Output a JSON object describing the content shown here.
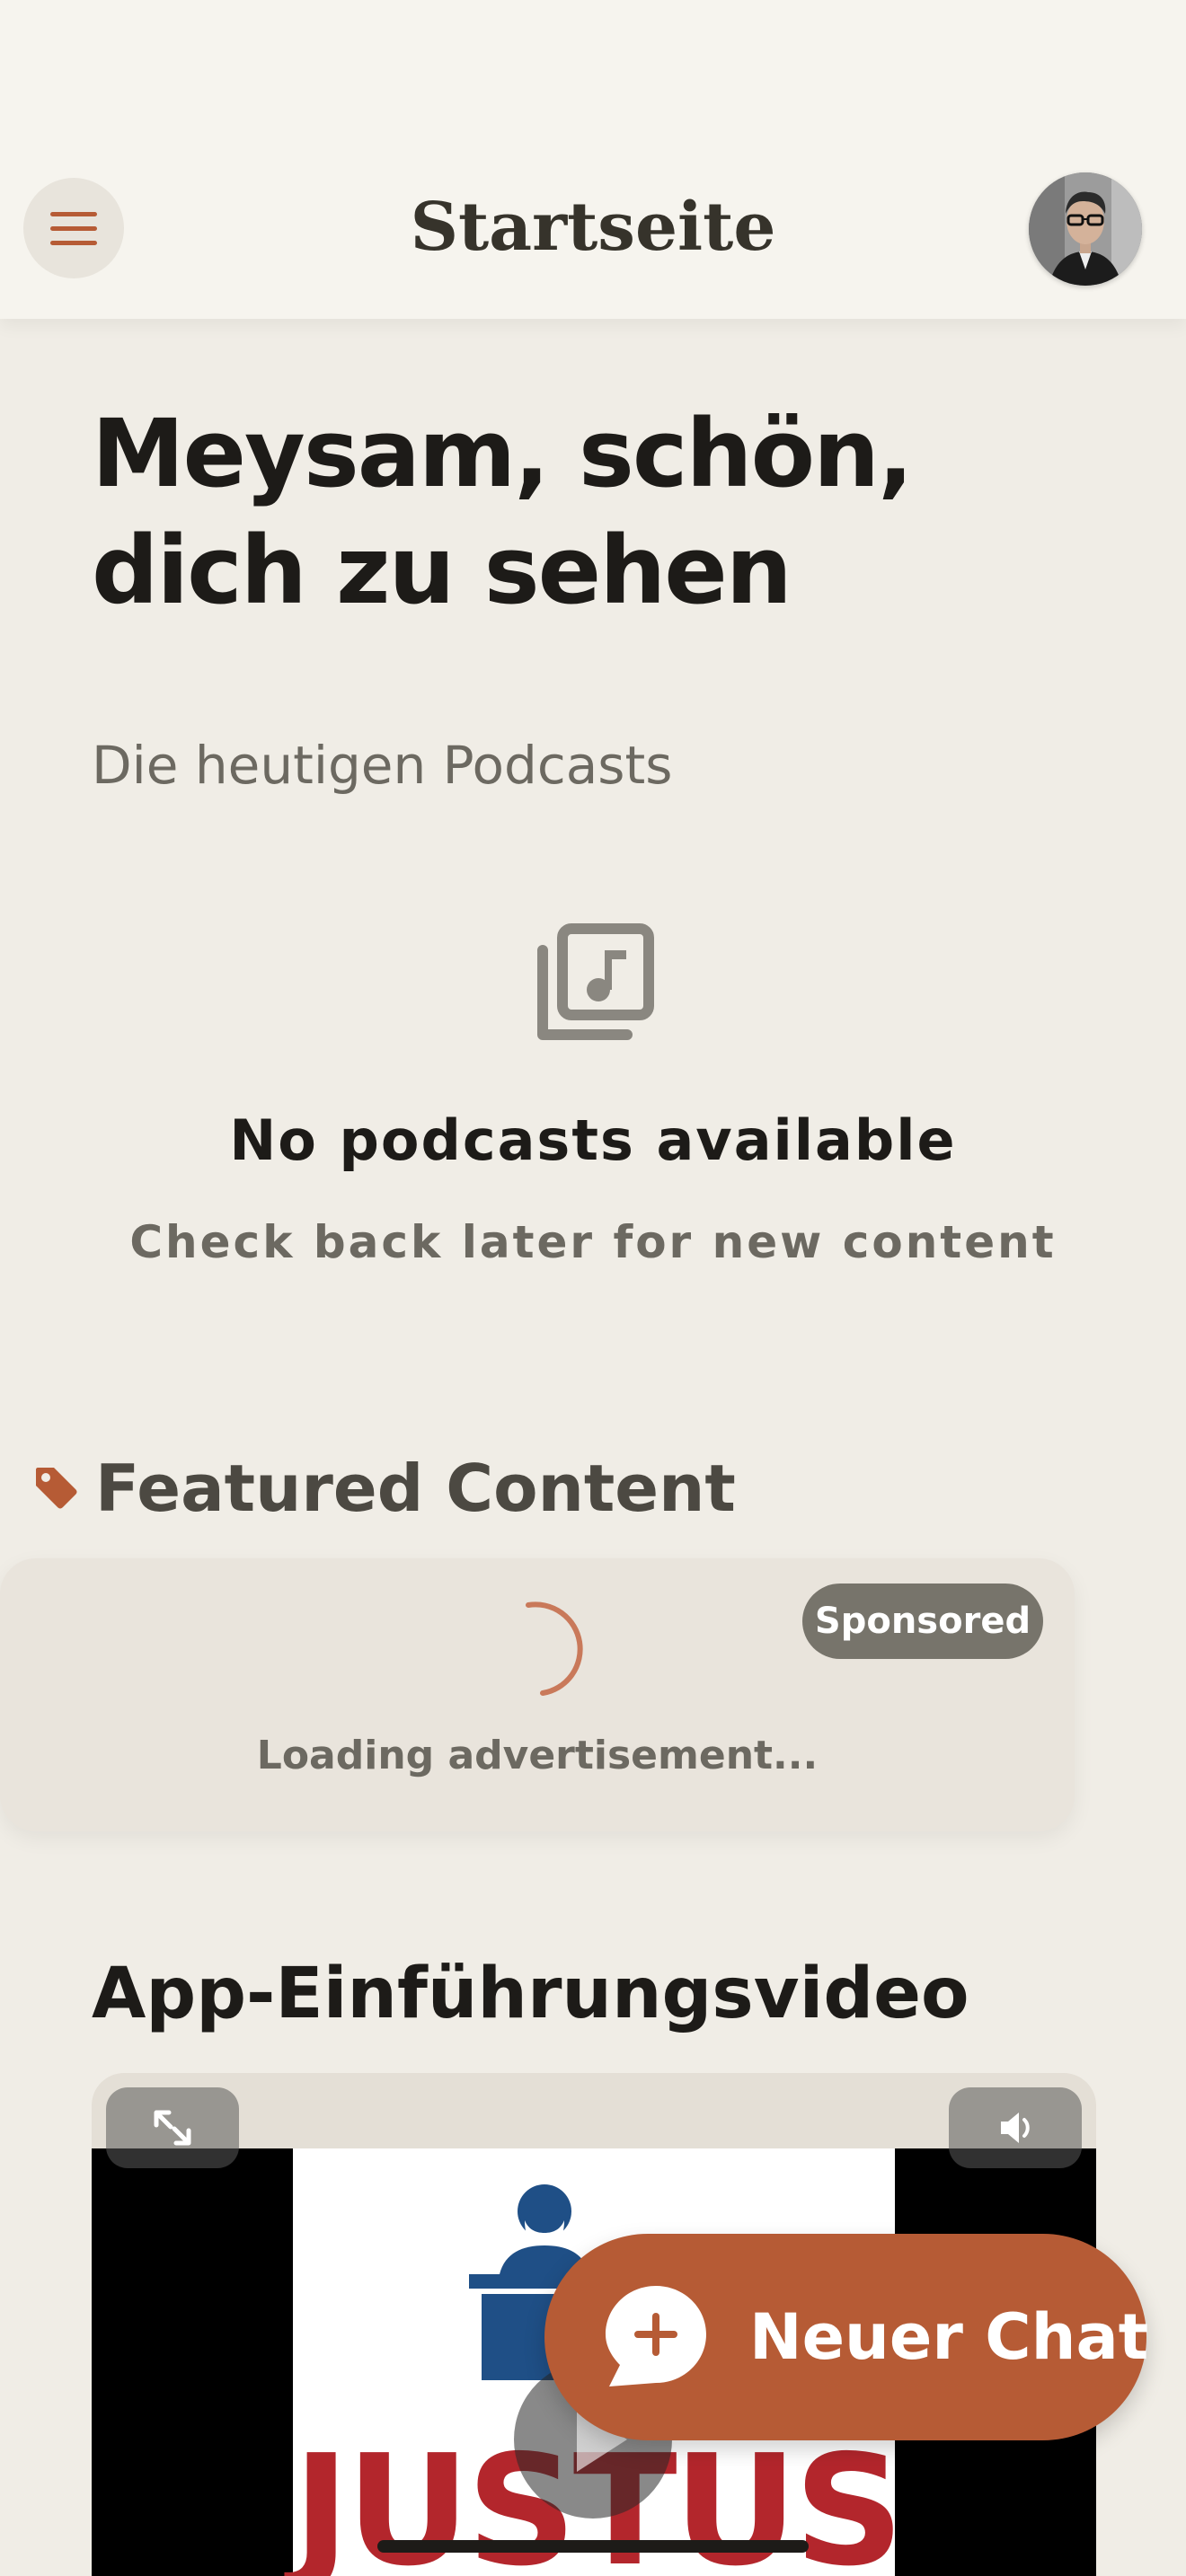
{
  "header": {
    "title": "Startseite",
    "menu_icon": "hamburger-menu-icon",
    "avatar_icon": "user-avatar"
  },
  "greeting": {
    "line1": "Meysam, schön,",
    "line2": "dich zu sehen",
    "subtitle": "Die heutigen Podcasts"
  },
  "podcasts_empty": {
    "icon": "music-library-icon",
    "title": "No podcasts available",
    "subtitle": "Check back later for new content"
  },
  "featured": {
    "icon": "tag-icon",
    "title": "Featured Content",
    "badge": "Sponsored",
    "loading_text": "Loading advertisement..."
  },
  "video": {
    "title": "App-Einführungsvideo",
    "brand_text": "JUSTUS",
    "fullscreen_icon": "expand-icon",
    "volume_icon": "volume-icon",
    "play_icon": "play-icon"
  },
  "fab": {
    "label": "Neuer Chat",
    "icon": "chat-plus-icon"
  },
  "colors": {
    "accent": "#b65b35",
    "background": "#f0ede6",
    "header_background": "#f6f4ee",
    "text_primary": "#1d1b18",
    "text_secondary": "#6c6961",
    "badge": "#77746b",
    "brand_red": "#b3262c",
    "brand_blue": "#1f4f86"
  }
}
